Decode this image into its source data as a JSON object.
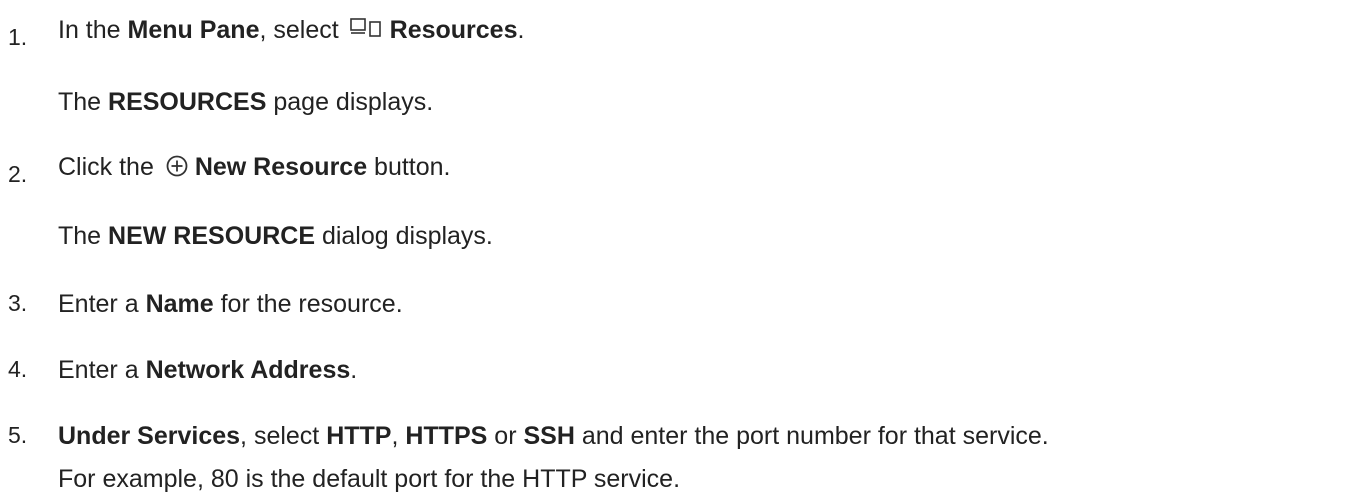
{
  "steps": [
    {
      "number": "1.",
      "parts": [
        "In the ",
        "Menu Pane",
        ", select ",
        "Resources",
        "."
      ],
      "icon": "resources-icon",
      "result": [
        "The ",
        "RESOURCES",
        " page displays."
      ]
    },
    {
      "number": "2.",
      "parts": [
        "Click the ",
        "New Resource",
        " button."
      ],
      "icon": "plus-circle-icon",
      "result": [
        "The ",
        "NEW RESOURCE",
        " dialog displays."
      ]
    },
    {
      "number": "3.",
      "parts": [
        "Enter a ",
        "Name",
        " for the resource."
      ]
    },
    {
      "number": "4.",
      "parts": [
        "Enter a ",
        "Network Address",
        "."
      ]
    },
    {
      "number": "5.",
      "parts": [
        "Under Services",
        ", select ",
        "HTTP",
        ", ",
        "HTTPS",
        " or ",
        "SSH",
        " and enter the port number for that service."
      ],
      "note": "For example, 80 is the default port for the HTTP service."
    }
  ]
}
